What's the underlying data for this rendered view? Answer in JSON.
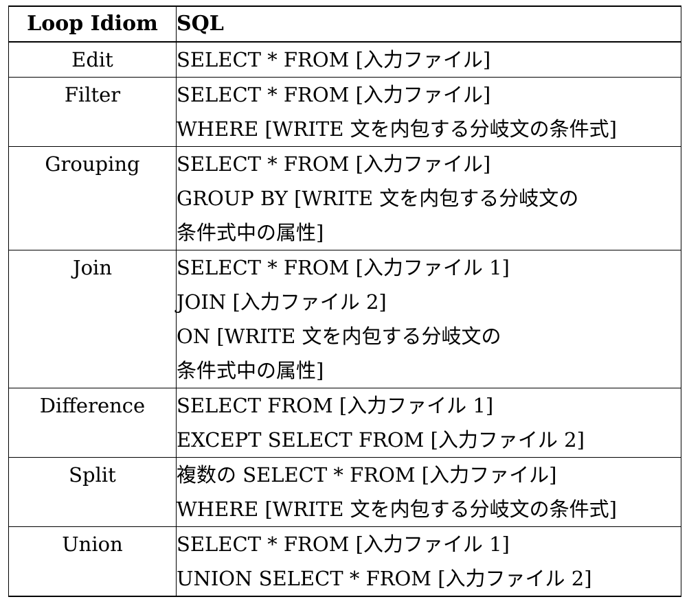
{
  "table": {
    "headers": {
      "idiom": "Loop Idiom",
      "sql": "SQL"
    },
    "rows": [
      {
        "idiom": "Edit",
        "sql_lines": [
          "SELECT * FROM [入力ファイル]"
        ]
      },
      {
        "idiom": "Filter",
        "sql_lines": [
          "SELECT * FROM [入力ファイル]",
          "WHERE [WRITE 文を内包する分岐文の条件式]"
        ]
      },
      {
        "idiom": "Grouping",
        "sql_lines": [
          "SELECT * FROM [入力ファイル]",
          "GROUP BY [WRITE 文を内包する分岐文の",
          "条件式中の属性]"
        ]
      },
      {
        "idiom": "Join",
        "sql_lines": [
          "SELECT * FROM [入力ファイル 1]",
          "JOIN [入力ファイル 2]",
          "ON [WRITE 文を内包する分岐文の",
          "条件式中の属性]"
        ]
      },
      {
        "idiom": "Difference",
        "sql_lines": [
          "SELECT FROM [入力ファイル 1]",
          "EXCEPT SELECT FROM [入力ファイル 2]"
        ]
      },
      {
        "idiom": "Split",
        "sql_lines": [
          "複数の SELECT * FROM [入力ファイル]",
          "WHERE [WRITE 文を内包する分岐文の条件式]"
        ]
      },
      {
        "idiom": "Union",
        "sql_lines": [
          "SELECT * FROM [入力ファイル 1]",
          "UNION SELECT * FROM [入力ファイル 2]"
        ]
      }
    ]
  },
  "style": {
    "text_color": "#000000",
    "background_color": "#ffffff",
    "border_color": "#000000"
  }
}
